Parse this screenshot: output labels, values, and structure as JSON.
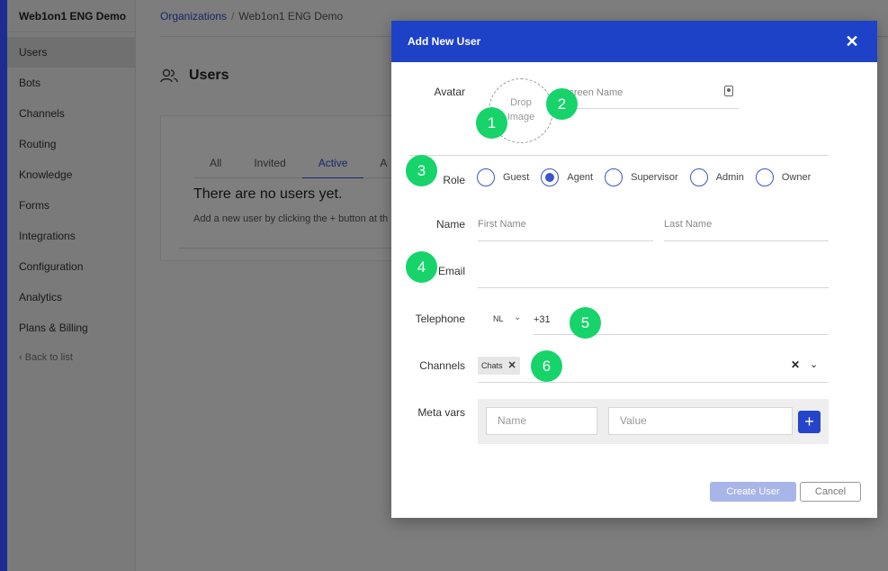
{
  "sidebar": {
    "org_name": "Web1on1 ENG Demo",
    "items": [
      {
        "label": "Users",
        "active": true
      },
      {
        "label": "Bots"
      },
      {
        "label": "Channels"
      },
      {
        "label": "Routing"
      },
      {
        "label": "Knowledge"
      },
      {
        "label": "Forms"
      },
      {
        "label": "Integrations"
      },
      {
        "label": "Configuration"
      },
      {
        "label": "Analytics"
      },
      {
        "label": "Plans & Billing"
      }
    ],
    "back_label": "Back to list"
  },
  "breadcrumb": {
    "link": "Organizations",
    "separator": "/",
    "current": "Web1on1 ENG Demo"
  },
  "page": {
    "title": "Users",
    "tabs": [
      "All",
      "Invited",
      "Active",
      "A"
    ],
    "active_tab": "Active",
    "empty_title": "There are no users yet.",
    "empty_sub": "Add a new user by clicking the + button at th"
  },
  "modal": {
    "title": "Add New User",
    "labels": {
      "avatar": "Avatar",
      "role": "Role",
      "name": "Name",
      "email": "Email",
      "telephone": "Telephone",
      "channels": "Channels",
      "meta_vars": "Meta vars"
    },
    "avatar_drop": {
      "line1": "Drop",
      "line2": "Image"
    },
    "screen_name_placeholder": "Screen Name",
    "roles": [
      "Guest",
      "Agent",
      "Supervisor",
      "Admin",
      "Owner"
    ],
    "selected_role": "Agent",
    "first_name_placeholder": "First Name",
    "last_name_placeholder": "Last Name",
    "country": "NL",
    "phone_value": "+31",
    "channel_chip": "Chats",
    "meta_name_placeholder": "Name",
    "meta_value_placeholder": "Value",
    "create_label": "Create User",
    "cancel_label": "Cancel"
  },
  "annotations": [
    "1",
    "2",
    "3",
    "4",
    "5",
    "6"
  ],
  "colors": {
    "header_blue": "#1d41c7",
    "badge_green": "#16d46a",
    "accent": "#2b4fd0"
  }
}
